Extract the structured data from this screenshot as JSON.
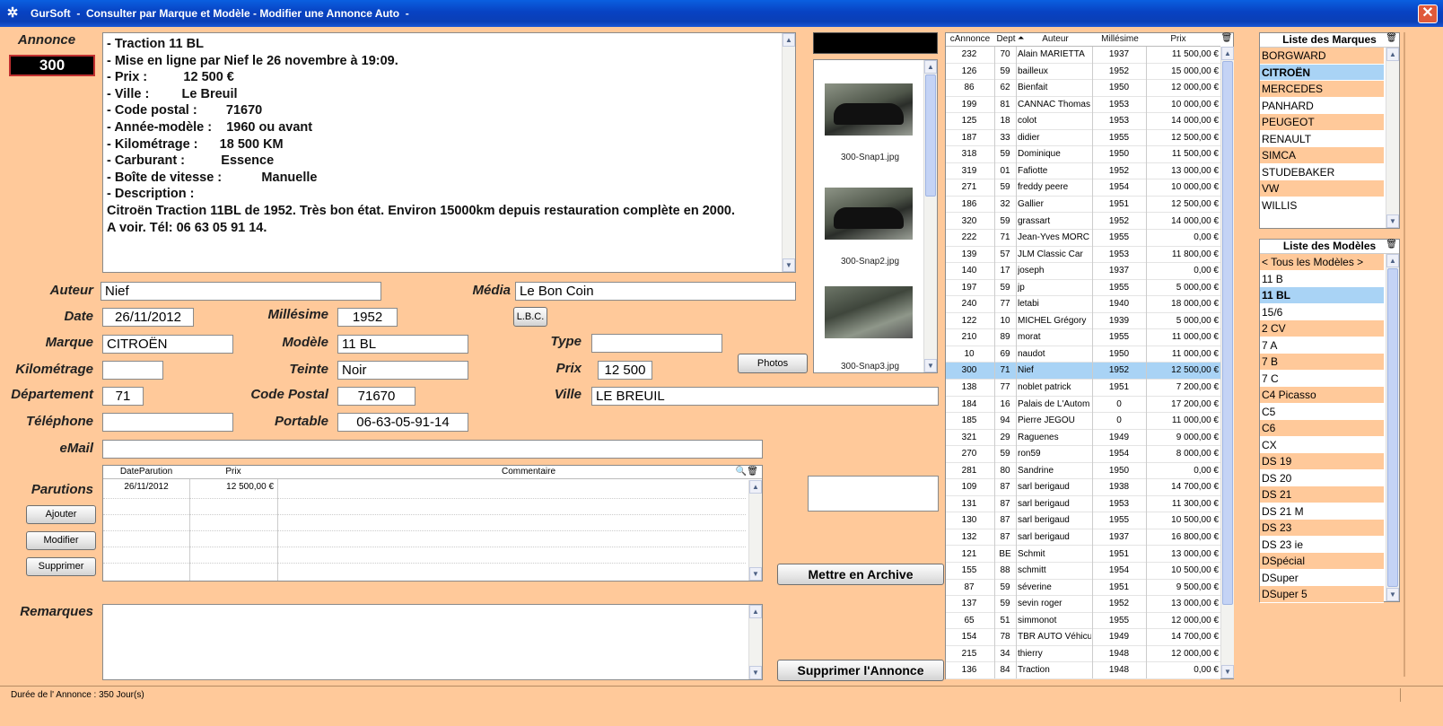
{
  "window": {
    "title": "GurSoft  -  Consulter par Marque et Modèle - Modifier une Annonce Auto  -"
  },
  "annonce": {
    "label": "Annonce",
    "number": "300",
    "text": [
      "- Traction 11 BL",
      "- Mise en ligne par Nief le 26 novembre à 19:09.",
      "- Prix :          12 500 €",
      "- Ville :         Le Breuil",
      "- Code postal :        71670",
      "- Année-modèle :    1960 ou avant",
      "- Kilométrage :      18 500 KM",
      "- Carburant :          Essence",
      "- Boîte de vitesse :           Manuelle",
      "- Description :",
      "Citroën Traction 11BL de 1952. Très bon état. Environ 15000km depuis restauration complète en 2000.",
      "A voir. Tél: 06 63 05 91 14."
    ]
  },
  "form": {
    "auteur_label": "Auteur",
    "auteur": "Nief",
    "media_label": "Média",
    "media": "Le Bon Coin",
    "date_label": "Date",
    "date": "26/11/2012",
    "millesime_label": "Millésime",
    "millesime": "1952",
    "lbc_button": "L.B.C.",
    "marque_label": "Marque",
    "marque": "CITROËN",
    "modele_label": "Modèle",
    "modele": "11 BL",
    "type_label": "Type",
    "type": "",
    "km_label": "Kilométrage",
    "km": "",
    "teinte_label": "Teinte",
    "teinte": "Noir",
    "prix_label": "Prix",
    "prix": "12 500",
    "photos_button": "Photos",
    "dept_label": "Département",
    "dept": "71",
    "cp_label": "Code Postal",
    "cp": "71670",
    "ville_label": "Ville",
    "ville": "LE BREUIL",
    "tel_label": "Téléphone",
    "tel": "",
    "portable_label": "Portable",
    "portable": "06-63-05-91-14",
    "email_label": "eMail",
    "email": "",
    "remarques_label": "Remarques"
  },
  "parutions": {
    "label": "Parutions",
    "headers": [
      "DateParution",
      "Prix",
      "Commentaire"
    ],
    "rows": [
      {
        "date": "26/11/2012",
        "prix": "12 500,00 €",
        "commentaire": ""
      }
    ],
    "add_button": "Ajouter",
    "edit_button": "Modifier",
    "delete_button": "Supprimer"
  },
  "photos": {
    "items": [
      {
        "caption": "300-Snap1.jpg"
      },
      {
        "caption": "300-Snap2.jpg"
      },
      {
        "caption": "300-Snap3.jpg"
      }
    ]
  },
  "actions": {
    "archive_button": "Mettre en Archive",
    "delete_ad_button": "Supprimer l'Annonce"
  },
  "listing": {
    "headers": [
      "cAnnonce",
      "Dept",
      "Auteur",
      "Millésime",
      "Prix"
    ],
    "rows": [
      [
        "232",
        "70",
        "Alain MARIETTA",
        "1937",
        "11 500,00 €"
      ],
      [
        "126",
        "59",
        "bailleux",
        "1952",
        "15 000,00 €"
      ],
      [
        "86",
        "62",
        "Bienfait",
        "1950",
        "12 000,00 €"
      ],
      [
        "199",
        "81",
        "CANNAC Thomas",
        "1953",
        "10 000,00 €"
      ],
      [
        "125",
        "18",
        "colot",
        "1953",
        "14 000,00 €"
      ],
      [
        "187",
        "33",
        "didier",
        "1955",
        "12 500,00 €"
      ],
      [
        "318",
        "59",
        "Dominique",
        "1950",
        "11 500,00 €"
      ],
      [
        "319",
        "01",
        "Fafiotte",
        "1952",
        "13 000,00 €"
      ],
      [
        "271",
        "59",
        "freddy peere",
        "1954",
        "10 000,00 €"
      ],
      [
        "186",
        "32",
        "Gallier",
        "1951",
        "12 500,00 €"
      ],
      [
        "320",
        "59",
        "grassart",
        "1952",
        "14 000,00 €"
      ],
      [
        "222",
        "71",
        "Jean-Yves MORC",
        "1955",
        "0,00 €"
      ],
      [
        "139",
        "57",
        "JLM Classic Car",
        "1953",
        "11 800,00 €"
      ],
      [
        "140",
        "17",
        "joseph",
        "1937",
        "0,00 €"
      ],
      [
        "197",
        "59",
        "jp",
        "1955",
        "5 000,00 €"
      ],
      [
        "240",
        "77",
        "letabi",
        "1940",
        "18 000,00 €"
      ],
      [
        "122",
        "10",
        "MICHEL Grégory",
        "1939",
        "5 000,00 €"
      ],
      [
        "210",
        "89",
        "morat",
        "1955",
        "11 000,00 €"
      ],
      [
        "10",
        "69",
        "naudot",
        "1950",
        "11 000,00 €"
      ],
      [
        "300",
        "71",
        "Nief",
        "1952",
        "12 500,00 €"
      ],
      [
        "138",
        "77",
        "noblet patrick",
        "1951",
        "7 200,00 €"
      ],
      [
        "184",
        "16",
        "Palais de L'Autom",
        "0",
        "17 200,00 €"
      ],
      [
        "185",
        "94",
        "Pierre JEGOU",
        "0",
        "11 000,00 €"
      ],
      [
        "321",
        "29",
        "Raguenes",
        "1949",
        "9 000,00 €"
      ],
      [
        "270",
        "59",
        "ron59",
        "1954",
        "8 000,00 €"
      ],
      [
        "281",
        "80",
        "Sandrine",
        "1950",
        "0,00 €"
      ],
      [
        "109",
        "87",
        "sarl berigaud",
        "1938",
        "14 700,00 €"
      ],
      [
        "131",
        "87",
        "sarl berigaud",
        "1953",
        "11 300,00 €"
      ],
      [
        "130",
        "87",
        "sarl berigaud",
        "1955",
        "10 500,00 €"
      ],
      [
        "132",
        "87",
        "sarl berigaud",
        "1937",
        "16 800,00 €"
      ],
      [
        "121",
        "BE",
        "Schmit",
        "1951",
        "13 000,00 €"
      ],
      [
        "155",
        "88",
        "schmitt",
        "1954",
        "10 500,00 €"
      ],
      [
        "87",
        "59",
        "séverine",
        "1951",
        "9 500,00 €"
      ],
      [
        "137",
        "59",
        "sevin roger",
        "1952",
        "13 000,00 €"
      ],
      [
        "65",
        "51",
        "simmonot",
        "1955",
        "12 000,00 €"
      ],
      [
        "154",
        "78",
        "TBR AUTO Véhicu",
        "1949",
        "14 700,00 €"
      ],
      [
        "215",
        "34",
        "thierry",
        "1948",
        "12 000,00 €"
      ],
      [
        "136",
        "84",
        "Traction",
        "1948",
        "0,00 €"
      ]
    ]
  },
  "marques": {
    "title": "Liste des Marques",
    "items": [
      "BORGWARD",
      "CITROËN",
      "MERCEDES",
      "PANHARD",
      "PEUGEOT",
      "RENAULT",
      "SIMCA",
      "STUDEBAKER",
      "VW",
      "WILLIS"
    ]
  },
  "modeles": {
    "title": "Liste des Modèles",
    "items": [
      "< Tous les Modèles >",
      "11 B",
      "11 BL",
      "15/6",
      "2 CV",
      "7 A",
      "7 B",
      "7 C",
      "C4 Picasso",
      "C5",
      "C6",
      "CX",
      "DS 19",
      "DS 20",
      "DS 21",
      "DS 21 M",
      "DS 23",
      "DS 23 ie",
      "DSpécial",
      "DSuper",
      "DSuper 5"
    ]
  },
  "status": {
    "text": "Durée de l' Annonce : 350 Jour(s)"
  }
}
